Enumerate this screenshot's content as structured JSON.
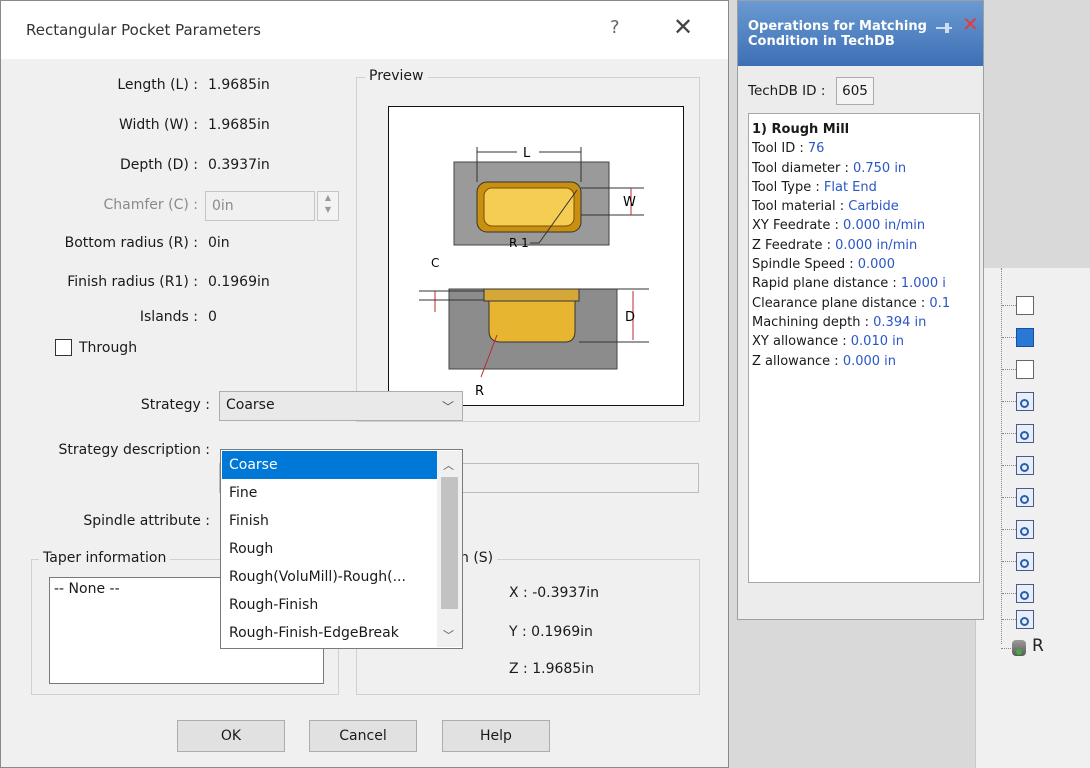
{
  "dialog": {
    "title": "Rectangular Pocket Parameters",
    "help_glyph": "?",
    "close_glyph": "✕",
    "fields": {
      "length": {
        "label": "Length (L) :",
        "value": "1.9685in"
      },
      "width": {
        "label": "Width (W) :",
        "value": "1.9685in"
      },
      "depth": {
        "label": "Depth (D) :",
        "value": "0.3937in"
      },
      "chamfer": {
        "label": "Chamfer (C) :",
        "value": "0in"
      },
      "bottom_radius": {
        "label": "Bottom radius (R) :",
        "value": "0in"
      },
      "finish_radius": {
        "label": "Finish radius (R1) :",
        "value": "0.1969in"
      },
      "islands": {
        "label": "Islands :",
        "value": "0"
      }
    },
    "through_label": "Through",
    "preview": {
      "caption": "Preview",
      "labels": {
        "L": "L",
        "W": "W",
        "R1": "R 1",
        "C": "C",
        "D": "D",
        "R": "R"
      }
    },
    "strategy": {
      "label": "Strategy :",
      "value": "Coarse"
    },
    "strategy_description_label": "Strategy description :",
    "spindle_attribute_label": "Spindle attribute :",
    "dropdown_options": [
      "Coarse",
      "Fine",
      "Finish",
      "Rough",
      "Rough(VoluMill)-Rough(...",
      "Rough-Finish",
      "Rough-Finish-EdgeBreak"
    ],
    "taper": {
      "caption": "Taper information",
      "value": "-- None --"
    },
    "position": {
      "caption_tail": "n (S)",
      "x": "X : -0.3937in",
      "y": "Y : 0.1969in",
      "z": "Z : 1.9685in"
    },
    "buttons": {
      "ok": "OK",
      "cancel": "Cancel",
      "help": "Help"
    }
  },
  "techdb": {
    "title": "Operations for Matching\nCondition in TechDB",
    "id_label": "TechDB ID :",
    "id_value": "605",
    "operation_heading": "1) Rough Mill",
    "lines": [
      {
        "k": "Tool ID : ",
        "v": "76"
      },
      {
        "k": "Tool diameter : ",
        "v": "0.750 in"
      },
      {
        "k": "Tool Type : ",
        "v": "Flat End"
      },
      {
        "k": "Tool material : ",
        "v": "Carbide"
      },
      {
        "k": "XY Feedrate : ",
        "v": "0.000 in/min"
      },
      {
        "k": "Z Feedrate : ",
        "v": "0.000 in/min"
      },
      {
        "k": "Spindle Speed : ",
        "v": "0.000"
      },
      {
        "k": "Rapid plane distance : ",
        "v": "1.000 i"
      },
      {
        "k": "Clearance plane distance : ",
        "v": "0.1"
      },
      {
        "k": "Machining depth : ",
        "v": "0.394 in"
      },
      {
        "k": "XY allowance : ",
        "v": "0.010 in"
      },
      {
        "k": "Z allowance : ",
        "v": "0.000 in"
      }
    ]
  },
  "tree": {
    "root_label": "R"
  },
  "colors": {
    "accent": "#0078d7",
    "value_blue": "#2a56c8",
    "title_blue": "#3d6fb5",
    "pocket_gold": "#e8b530"
  }
}
